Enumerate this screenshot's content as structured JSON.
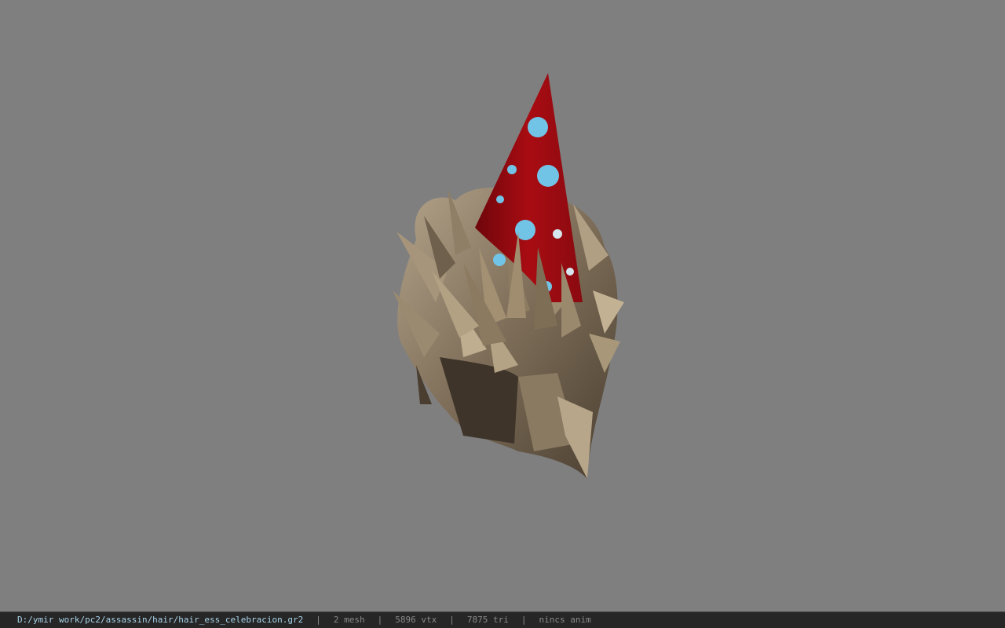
{
  "viewport": {
    "model_icon": "hair-mesh-with-party-hat",
    "background_color": "#7f7f7f",
    "hat_color": "#9b0a10",
    "hat_dot_color": "#72c4e6",
    "hair_color": "#8b7c66"
  },
  "status_bar": {
    "file_path": "D:/ymir work/pc2/assassin/hair/hair_ess_celebracion.gr2",
    "separator": "|",
    "mesh_count": "2 mesh",
    "vertex_count": "5896 vtx",
    "triangle_count": "7875 tri",
    "anim_status": "nincs anim",
    "path_color": "#a9d4ea",
    "background_color": "#262626"
  }
}
